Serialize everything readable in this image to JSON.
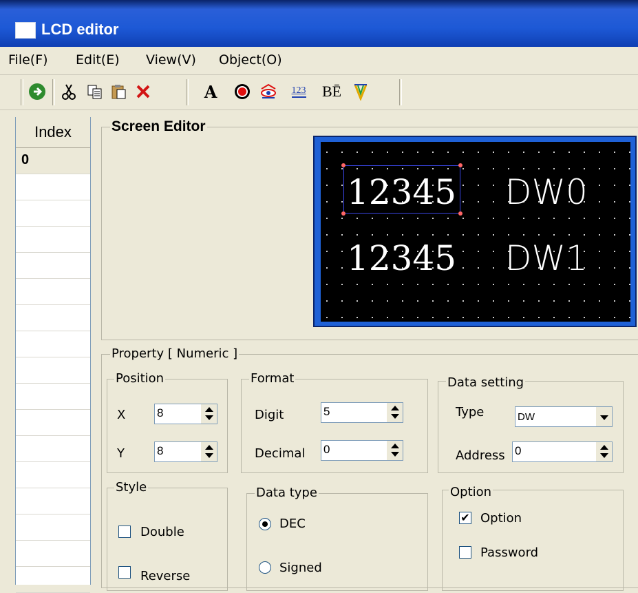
{
  "window": {
    "title": "LCD editor"
  },
  "menu": [
    "File(F)",
    "Edit(E)",
    "View(V)",
    "Object(O)"
  ],
  "toolbar": {
    "icons": [
      "go-icon",
      "cut-icon",
      "copy-icon",
      "paste-icon",
      "delete-icon",
      "text-icon",
      "lamp-icon",
      "eye-icon",
      "numeric-icon",
      "bitmap-text-icon",
      "color-icon"
    ],
    "text_tool": "A",
    "numeric_tool": "123",
    "bit_text_tool": "BĒ"
  },
  "index_panel": {
    "header": "Index",
    "rows": [
      "0",
      "",
      "",
      "",
      "",
      "",
      "",
      "",
      "",
      "",
      "",
      "",
      "",
      "",
      "",
      "",
      ""
    ]
  },
  "screen_editor": {
    "label": "Screen Editor",
    "lcd": {
      "row1_value": "12345",
      "row1_var": "DW0",
      "row2_value": "12345",
      "row2_var": "DW1"
    }
  },
  "property": {
    "label": "Property [ Numeric ]",
    "position": {
      "label": "Position",
      "x_label": "X",
      "x_value": "8",
      "y_label": "Y",
      "y_value": "8"
    },
    "format": {
      "label": "Format",
      "digit_label": "Digit",
      "digit_value": "5",
      "decimal_label": "Decimal",
      "decimal_value": "0"
    },
    "data_setting": {
      "label": "Data setting",
      "type_label": "Type",
      "type_value": "DW",
      "address_label": "Address",
      "address_value": "0"
    },
    "style": {
      "label": "Style",
      "double_label": "Double",
      "double_checked": false,
      "reverse_label": "Reverse",
      "reverse_checked": false
    },
    "data_type": {
      "label": "Data type",
      "dec_label": "DEC",
      "dec_selected": true,
      "signed_label": "Signed",
      "signed_selected": false
    },
    "option": {
      "label": "Option",
      "option_label": "Option",
      "option_checked": true,
      "password_label": "Password",
      "password_checked": false
    }
  },
  "colors": {
    "title_bar": "#1d59d6",
    "lcd_background": "#000000",
    "lcd_frame": "#1f61d6",
    "window_face": "#ece9d8"
  }
}
